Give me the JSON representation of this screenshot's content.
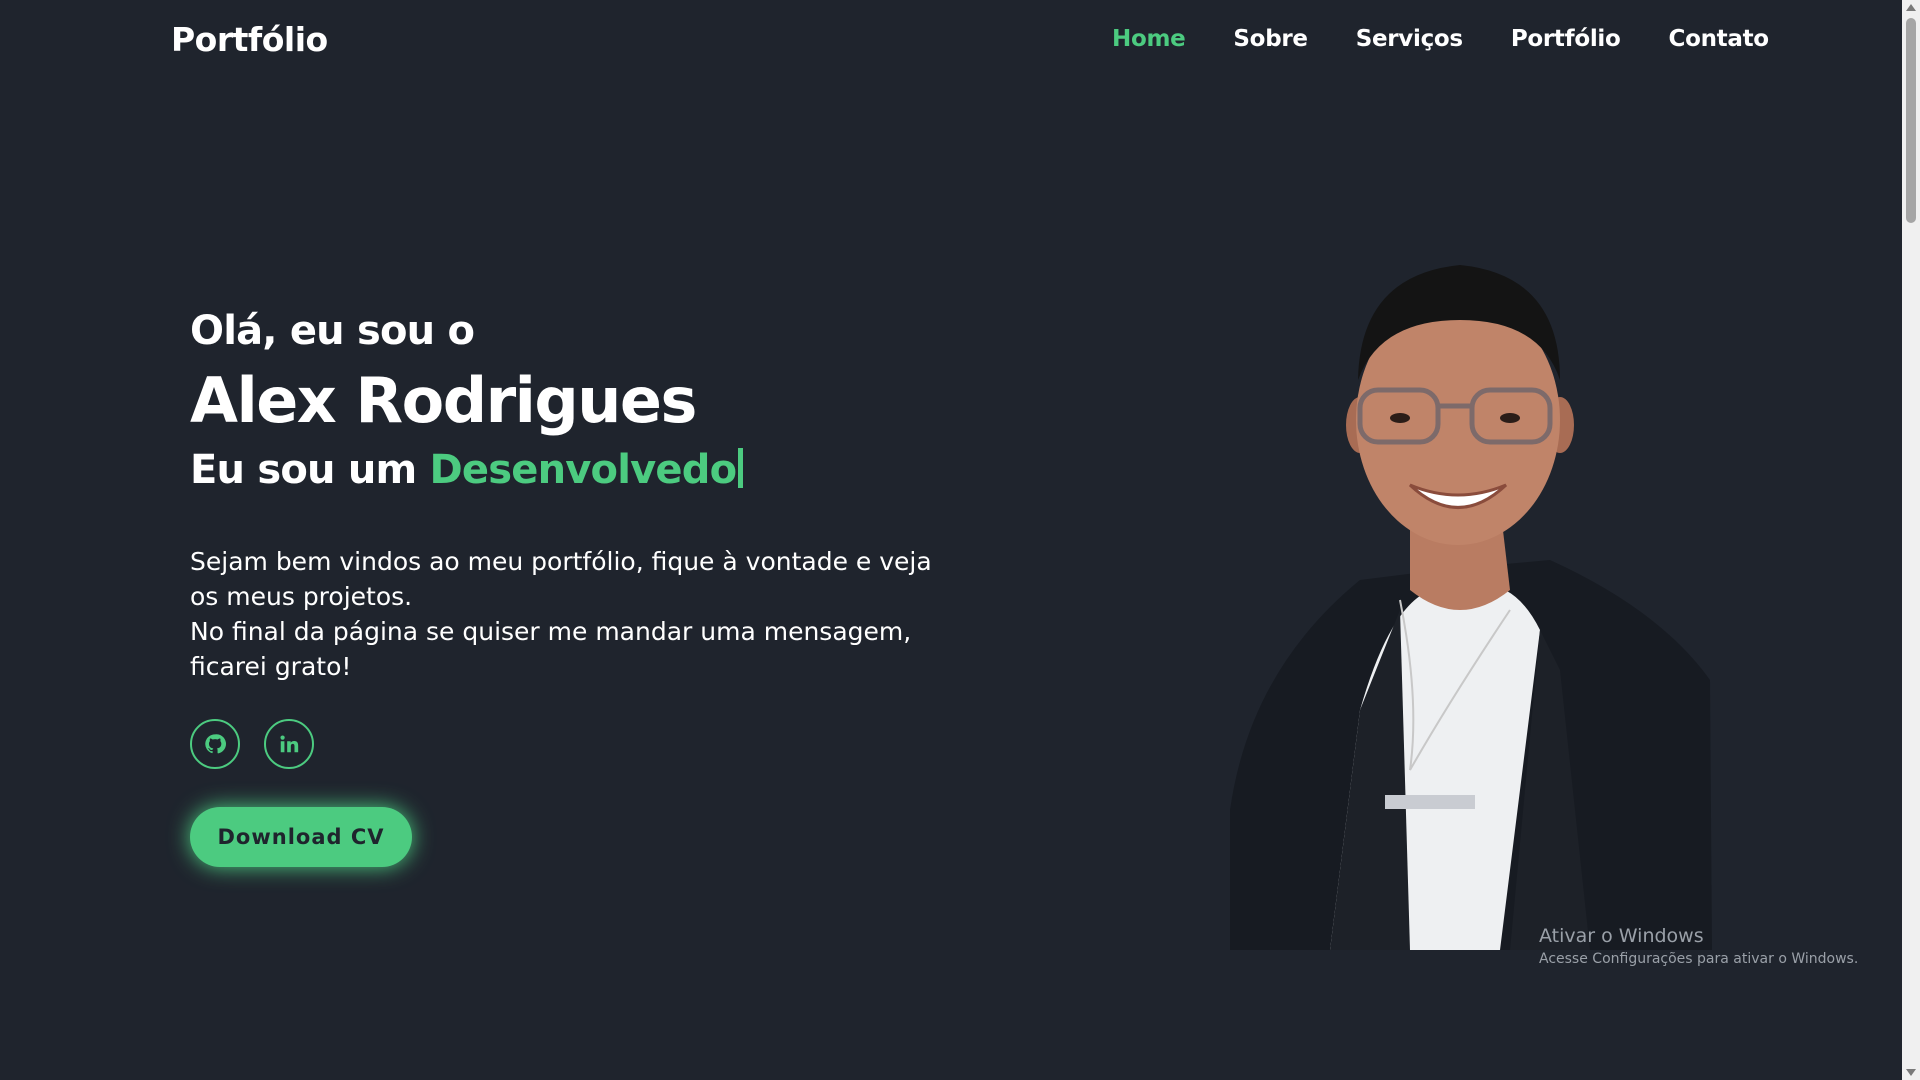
{
  "brand": {
    "logo": "Portfólio",
    "accent_color": "#4ccb80",
    "background": "#1f242d"
  },
  "nav": {
    "items": [
      {
        "label": "Home",
        "active": true
      },
      {
        "label": "Sobre",
        "active": false
      },
      {
        "label": "Serviços",
        "active": false
      },
      {
        "label": "Portfólio",
        "active": false
      },
      {
        "label": "Contato",
        "active": false
      }
    ]
  },
  "hero": {
    "greeting": "Olá, eu sou o",
    "name": "Alex Rodrigues",
    "role_prefix": "Eu sou um",
    "role_typed": "Desenvolvedo",
    "intro_line1": "Sejam bem vindos ao meu portfólio, fique à vontade e veja os meus projetos.",
    "intro_line2": "No final da página se quiser me mandar uma mensagem, ficarei grato!",
    "socials": [
      {
        "icon": "github-icon"
      },
      {
        "icon": "linkedin-icon"
      }
    ],
    "download_label": "Download CV"
  },
  "watermark": {
    "title": "Ativar o Windows",
    "subtitle": "Acesse Configurações para ativar o Windows."
  }
}
